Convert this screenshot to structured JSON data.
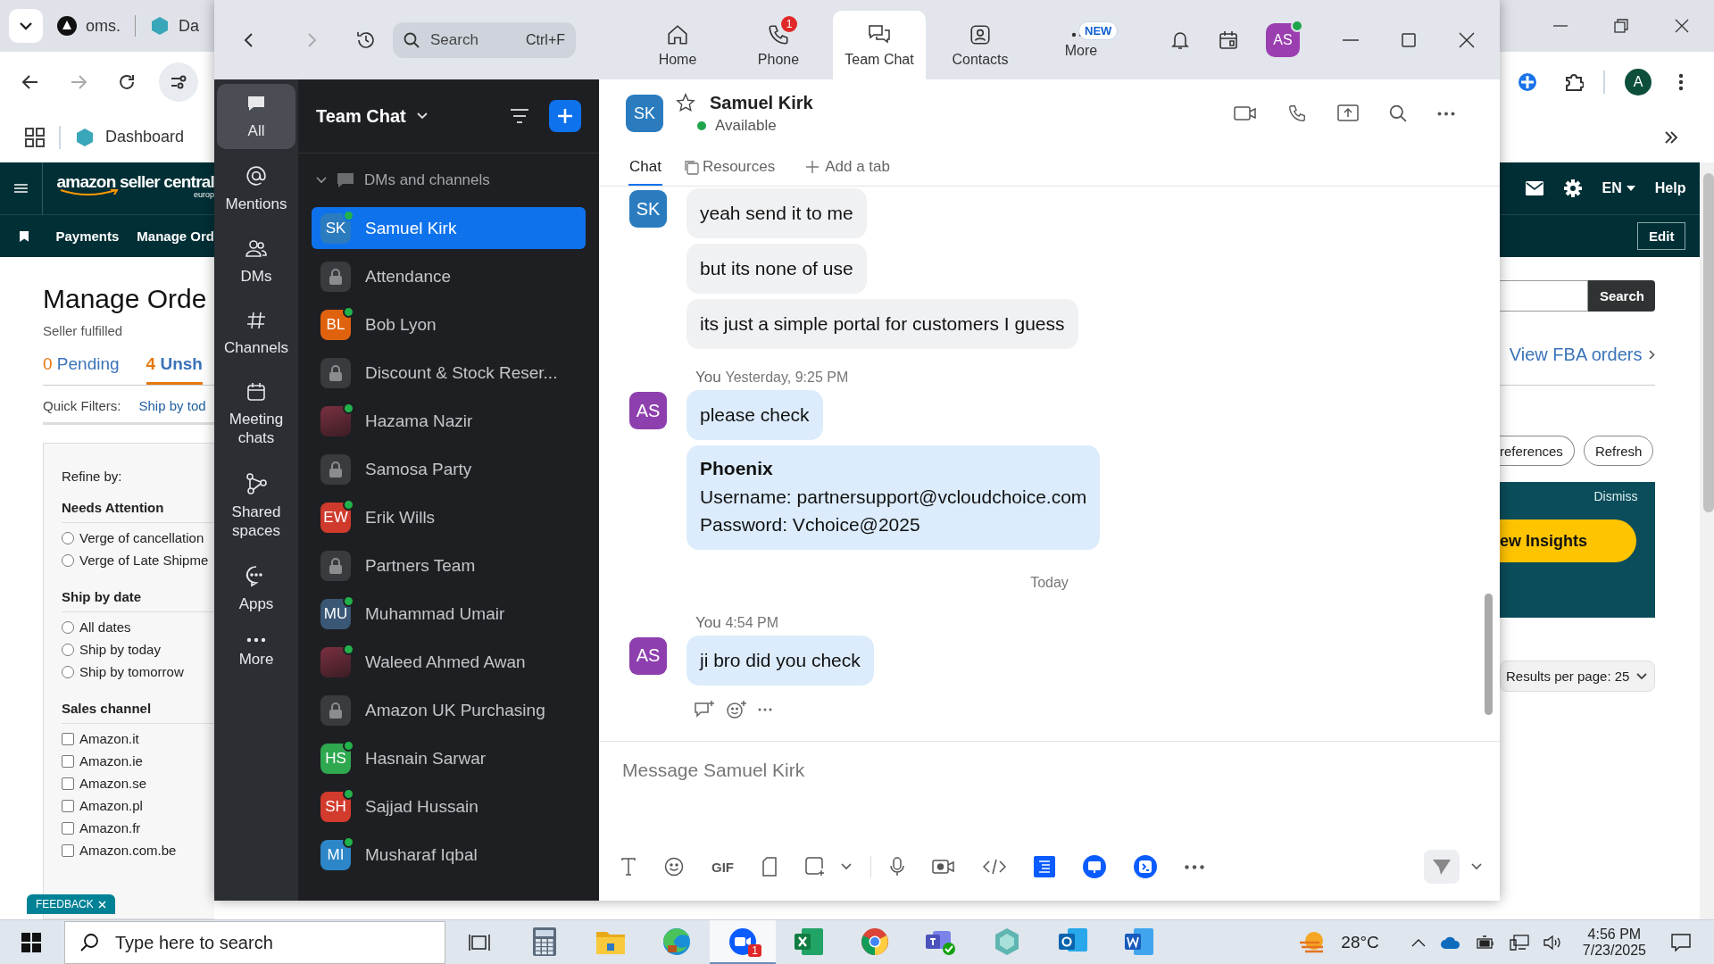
{
  "browser": {
    "tabs": [
      "oms.",
      "Da"
    ],
    "bookmarks": [
      "Dashboard"
    ],
    "profile_initial": "A",
    "page": {
      "logo": "amazon seller central",
      "logo_sub": "europ",
      "language": "EN",
      "help": "Help",
      "nav": [
        "Payments",
        "Manage Ord"
      ],
      "edit_button": "Edit",
      "title": "Manage Orde",
      "subtitle": "Seller fulfilled",
      "order_tabs": [
        {
          "count": "0",
          "label": "Pending",
          "selected": false
        },
        {
          "count": "4",
          "label": "Unsh",
          "selected": true
        }
      ],
      "quick_filters": {
        "label": "Quick Filters:",
        "links": [
          "Ship by tod"
        ]
      },
      "refine": {
        "title": "Refine by:",
        "groups": [
          {
            "title": "Needs Attention",
            "kind": "radio",
            "options": [
              {
                "label": "Verge of cancellation",
                "checked": false
              },
              {
                "label": "Verge of Late Shipme",
                "checked": false
              }
            ]
          },
          {
            "title": "Ship by date",
            "kind": "radio",
            "options": [
              {
                "label": "All dates",
                "checked": false
              },
              {
                "label": "Ship by today",
                "checked": false
              },
              {
                "label": "Ship by tomorrow",
                "checked": false
              }
            ]
          },
          {
            "title": "Sales channel",
            "kind": "checkbox",
            "options": [
              {
                "label": "Amazon.it",
                "checked": false
              },
              {
                "label": "Amazon.ie",
                "checked": false
              },
              {
                "label": "Amazon.se",
                "checked": false
              },
              {
                "label": "Amazon.pl",
                "checked": false
              },
              {
                "label": "Amazon.fr",
                "checked": false
              },
              {
                "label": "Amazon.com.be",
                "checked": false
              }
            ]
          }
        ]
      },
      "search_button": "Search",
      "fba_link": "View FBA orders",
      "buttons": [
        "references",
        "Refresh"
      ],
      "banner": {
        "dismiss": "Dismiss",
        "action": "ew Insights"
      },
      "results_per_page": "Results per page: 25",
      "feedback": "FEEDBACK"
    }
  },
  "zoom": {
    "search": {
      "placeholder": "Search",
      "shortcut": "Ctrl+F"
    },
    "nav_tabs": [
      {
        "label": "Home",
        "selected": false
      },
      {
        "label": "Phone",
        "badge": "1",
        "selected": false
      },
      {
        "label": "Team Chat",
        "selected": true
      },
      {
        "label": "Contacts",
        "selected": false
      },
      {
        "label": "More",
        "tag": "NEW",
        "selected": false
      }
    ],
    "profile": {
      "initials": "AS",
      "online": true
    },
    "sidebar": [
      {
        "label": "All",
        "selected": true
      },
      {
        "label": "Mentions",
        "selected": false
      },
      {
        "label": "DMs",
        "selected": false
      },
      {
        "label": "Channels",
        "selected": false
      },
      {
        "label": "Meeting chats",
        "selected": false
      },
      {
        "label": "Shared spaces",
        "selected": false
      },
      {
        "label": "Apps",
        "selected": false
      },
      {
        "label": "More",
        "selected": false
      }
    ],
    "list_title": "Team Chat",
    "section": {
      "label": "DMs and channels",
      "expanded": true
    },
    "conversations": [
      {
        "kind": "person",
        "name": "Samuel Kirk",
        "initials": "SK",
        "color": "#2b7cbf",
        "online": true,
        "selected": true
      },
      {
        "kind": "channel",
        "name": "Attendance",
        "online": false,
        "selected": false
      },
      {
        "kind": "person",
        "name": "Bob Lyon",
        "initials": "BL",
        "color": "#e0620f",
        "online": true,
        "selected": false
      },
      {
        "kind": "channel",
        "name": "Discount & Stock Reser...",
        "online": false,
        "selected": false
      },
      {
        "kind": "photo",
        "name": "Hazama Nazir",
        "online": true,
        "selected": false
      },
      {
        "kind": "channel",
        "name": "Samosa Party",
        "online": false,
        "selected": false
      },
      {
        "kind": "person",
        "name": "Erik Wills",
        "initials": "EW",
        "color": "#cf3a2c",
        "online": true,
        "selected": false
      },
      {
        "kind": "channel",
        "name": "Partners Team",
        "online": false,
        "selected": false
      },
      {
        "kind": "person",
        "name": "Muhammad Umair",
        "initials": "MU",
        "color": "#3a5875",
        "online": true,
        "selected": false
      },
      {
        "kind": "photo",
        "name": "Waleed Ahmed Awan",
        "online": true,
        "selected": false
      },
      {
        "kind": "channel",
        "name": "Amazon UK Purchasing",
        "online": false,
        "selected": false
      },
      {
        "kind": "person",
        "name": "Hasnain Sarwar",
        "initials": "HS",
        "color": "#2fa84f",
        "online": true,
        "selected": false
      },
      {
        "kind": "person",
        "name": "Sajjad Hussain",
        "initials": "SH",
        "color": "#d33b2d",
        "online": true,
        "selected": false
      },
      {
        "kind": "person",
        "name": "Musharaf Iqbal",
        "initials": "MI",
        "color": "#2d86c8",
        "online": true,
        "selected": false
      }
    ],
    "chat": {
      "contact": {
        "initials": "SK",
        "name": "Samuel Kirk",
        "status": "Available",
        "online": true
      },
      "tabs": [
        {
          "label": "Chat",
          "selected": true
        },
        {
          "label": "Resources",
          "selected": false
        }
      ],
      "add_tab": "Add a tab",
      "items": [
        {
          "kind": "group",
          "mine": false,
          "initials": "SK",
          "color": "#2b7cbf",
          "bubbles": [
            {
              "kind": "text",
              "text": "yeah send it to me"
            },
            {
              "kind": "text",
              "text": "but its none of use"
            },
            {
              "kind": "text",
              "text": "its just a simple portal for customers I guess"
            }
          ]
        },
        {
          "kind": "group",
          "mine": true,
          "sender": "You",
          "time": "Yesterday, 9:25 PM",
          "initials": "AS",
          "color": "#8e3fae",
          "bubbles": [
            {
              "kind": "text",
              "text": "please check"
            },
            {
              "kind": "card",
              "title": "Phoenix",
              "lines": [
                "Username: partnersupport@vcloudchoice.com",
                "Password: Vchoice@2025"
              ]
            }
          ]
        },
        {
          "kind": "divider",
          "text": "Today"
        },
        {
          "kind": "group",
          "mine": true,
          "sender": "You",
          "time": "4:54 PM",
          "initials": "AS",
          "color": "#8e3fae",
          "bubbles": [
            {
              "kind": "text",
              "text": "ji bro did you check"
            }
          ],
          "actions": true
        }
      ],
      "composer": {
        "placeholder": "Message Samuel Kirk",
        "gif_label": "GIF"
      }
    }
  },
  "taskbar": {
    "search_placeholder": "Type here to search",
    "apps": [
      {
        "selected": false
      },
      {
        "selected": false
      },
      {
        "selected": false
      },
      {
        "selected": true,
        "badge": "1"
      },
      {
        "selected": false
      },
      {
        "selected": false
      },
      {
        "selected": false
      },
      {
        "selected": false
      },
      {
        "selected": false
      },
      {
        "selected": false
      }
    ],
    "weather": "28°C",
    "time": "4:56 PM",
    "date": "7/23/2025"
  }
}
